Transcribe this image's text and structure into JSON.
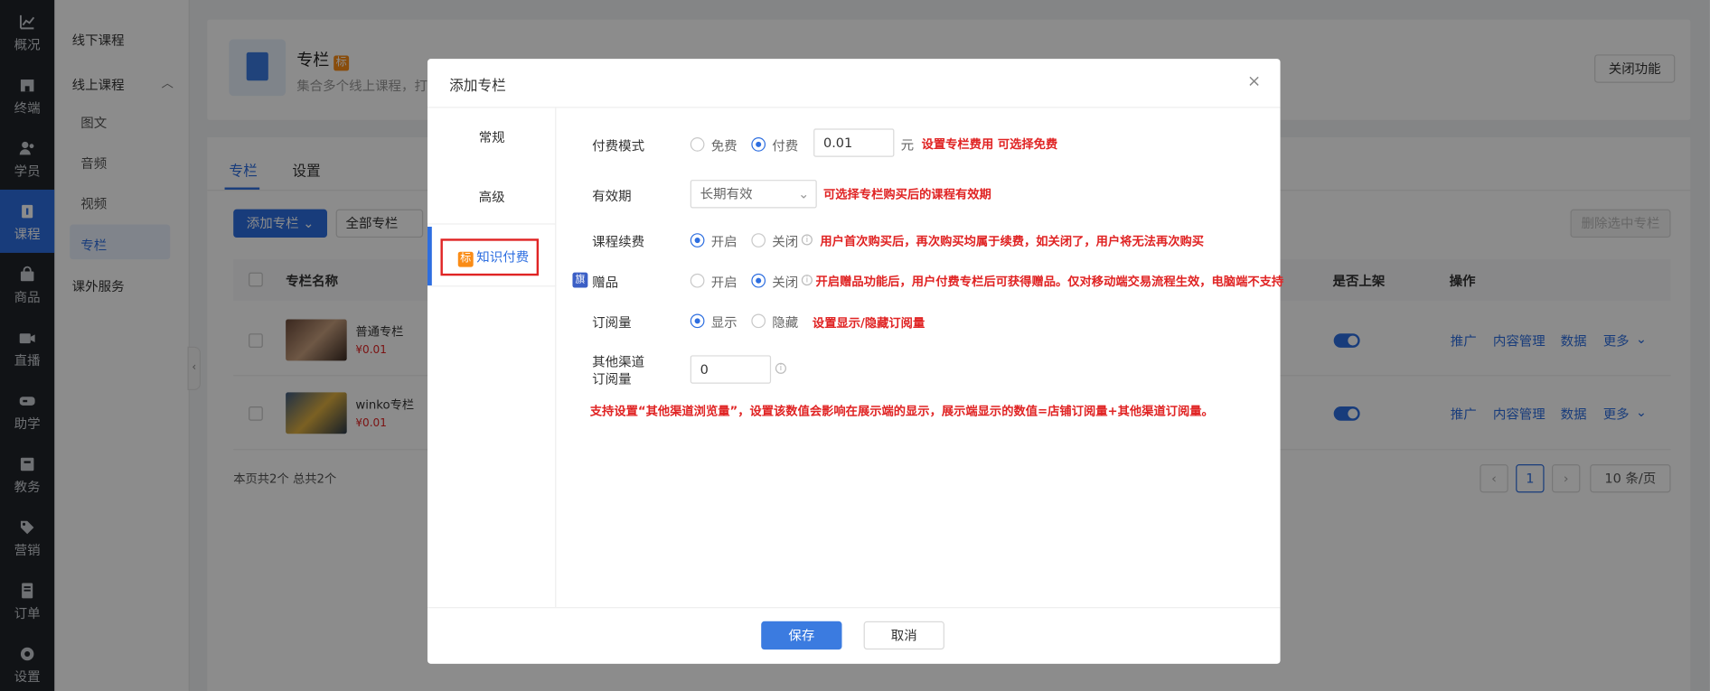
{
  "rail": {
    "items": [
      {
        "label": "概况",
        "icon": "chart-icon"
      },
      {
        "label": "终端",
        "icon": "store-icon"
      },
      {
        "label": "学员",
        "icon": "users-icon"
      },
      {
        "label": "课程",
        "icon": "book-icon"
      },
      {
        "label": "商品",
        "icon": "bag-icon"
      },
      {
        "label": "直播",
        "icon": "camera-icon"
      },
      {
        "label": "助学",
        "icon": "gamepad-icon"
      },
      {
        "label": "教务",
        "icon": "folder-icon"
      },
      {
        "label": "营销",
        "icon": "tag-icon"
      },
      {
        "label": "订单",
        "icon": "receipt-icon"
      },
      {
        "label": "设置",
        "icon": "gear-icon"
      }
    ]
  },
  "subnav": {
    "offline": "线下课程",
    "online": "线上课程",
    "children": [
      "图文",
      "音频",
      "视频",
      "专栏"
    ],
    "outside": "课外服务"
  },
  "header_card": {
    "title": "专栏",
    "tag": "标",
    "desc": "集合多个线上课程，打",
    "close_btn": "关闭功能"
  },
  "main": {
    "tabs": [
      "专栏",
      "设置"
    ],
    "add_btn": "添加专栏",
    "filter": "全部专栏",
    "batch_delete": "删除选中专栏",
    "columns": {
      "name": "专栏名称",
      "onshelf": "是否上架",
      "ops": "操作"
    },
    "rows": [
      {
        "name": "普通专栏",
        "price": "¥0.01"
      },
      {
        "name": "winko专栏",
        "price": "¥0.01"
      }
    ],
    "row_ops": [
      "推广",
      "内容管理",
      "数据",
      "更多"
    ],
    "summary": "本页共2个 总共2个",
    "page": "1",
    "page_size": "10 条/页"
  },
  "modal": {
    "title": "添加专栏",
    "close": "×",
    "tabs": {
      "normal": "常规",
      "advanced": "高级",
      "paid_tag": "标",
      "paid": "知识付费"
    },
    "pay_mode": {
      "label": "付费模式",
      "free": "免费",
      "paid": "付费",
      "amount": "0.01",
      "unit": "元",
      "note": "设置专栏费用 可选择免费"
    },
    "validity": {
      "label": "有效期",
      "value": "长期有效",
      "note": "可选择专栏购买后的课程有效期"
    },
    "renewal": {
      "label": "课程续费",
      "on": "开启",
      "off": "关闭",
      "note": "用户首次购买后，再次购买均属于续费，如关闭了，用户将无法再次购买"
    },
    "gift": {
      "badge": "旗",
      "label": "赠品",
      "on": "开启",
      "off": "关闭",
      "note": "开启赠品功能后，用户付费专栏后可获得赠品。仅对移动端交易流程生效，电脑端不支持"
    },
    "subscriptions": {
      "label": "订阅量",
      "show": "显示",
      "hide": "隐藏",
      "note": "设置显示/隐藏订阅量"
    },
    "other": {
      "label1": "其他渠道",
      "label2": "订阅量",
      "value": "0"
    },
    "bottom_note": "支持设置“其他渠道浏览量”，设置该数值会影响在展示端的显示，展示端显示的数值=店铺订阅量+其他渠道订阅量。",
    "save": "保存",
    "cancel": "取消"
  },
  "colors": {
    "primary": "#2d6ee0",
    "note_red": "#e02424",
    "tag_orange": "#fa8c16"
  }
}
